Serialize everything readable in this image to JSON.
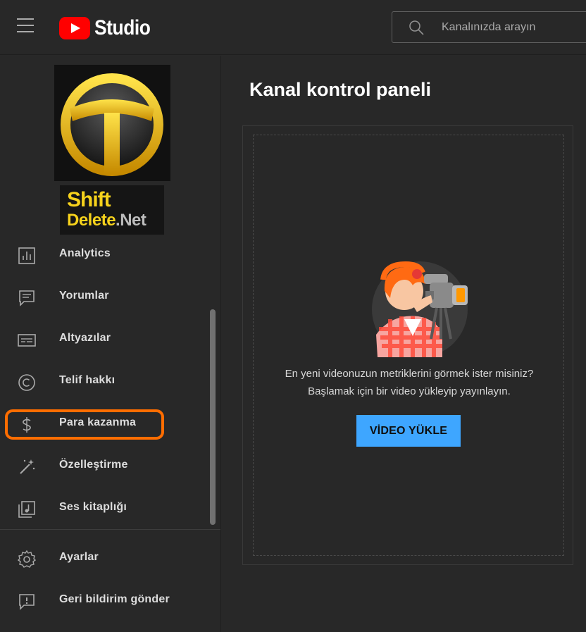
{
  "app": {
    "title": "Studio"
  },
  "search": {
    "placeholder": "Kanalınızda arayın"
  },
  "brand": {
    "line1": "Shift",
    "line2_main": "Delete",
    "line2_suffix": ".Net"
  },
  "sidebar": {
    "items": [
      {
        "label": "Analytics",
        "icon": "analytics-icon"
      },
      {
        "label": "Yorumlar",
        "icon": "comments-icon"
      },
      {
        "label": "Altyazılar",
        "icon": "subtitles-icon"
      },
      {
        "label": "Telif hakkı",
        "icon": "copyright-icon"
      },
      {
        "label": "Para kazanma",
        "icon": "dollar-icon"
      },
      {
        "label": "Özelleştirme",
        "icon": "magic-wand-icon"
      },
      {
        "label": "Ses kitaplığı",
        "icon": "audio-library-icon"
      },
      {
        "label": "Ayarlar",
        "icon": "gear-icon"
      },
      {
        "label": "Geri bildirim gönder",
        "icon": "feedback-icon"
      }
    ]
  },
  "main": {
    "title": "Kanal kontrol paneli",
    "empty_line1": "En yeni videonuzun metriklerini görmek ister misiniz?",
    "empty_line2": "Başlamak için bir video yükleyip yayınlayın.",
    "upload_label": "VİDEO YÜKLE"
  },
  "colors": {
    "accent": "#3ea6ff",
    "highlight": "#ff6d00",
    "brand_red": "#ff0000",
    "bg": "#282828"
  }
}
